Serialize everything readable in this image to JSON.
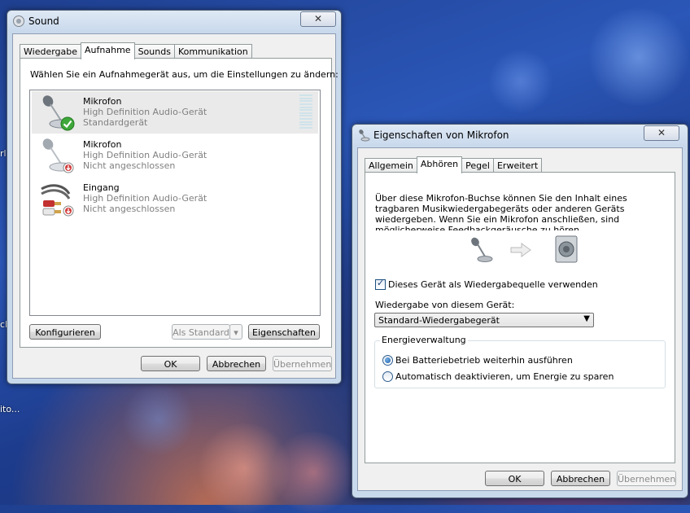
{
  "desktop": {
    "labels": [
      "rl",
      "ch",
      "ito..."
    ]
  },
  "sound": {
    "title": "Sound",
    "close": "✕",
    "tabs": [
      "Wiedergabe",
      "Aufnahme",
      "Sounds",
      "Kommunikation"
    ],
    "instruction": "Wählen Sie ein Aufnahmegerät aus, um die Einstellungen zu ändern:",
    "devices": [
      {
        "name": "Mikrofon",
        "line1": "High Definition Audio-Gerät",
        "line2": "Standardgerät",
        "icon": "microphone-icon",
        "status": "default-check-icon"
      },
      {
        "name": "Mikrofon",
        "line1": "High Definition Audio-Gerät",
        "line2": "Nicht angeschlossen",
        "icon": "microphone-icon",
        "status": "disconnected-icon"
      },
      {
        "name": "Eingang",
        "line1": "High Definition Audio-Gerät",
        "line2": "Nicht angeschlossen",
        "icon": "rca-cable-icon",
        "status": "disconnected-icon"
      }
    ],
    "buttons": {
      "configure": "Konfigurieren",
      "set_default": "Als Standard",
      "properties": "Eigenschaften",
      "ok": "OK",
      "cancel": "Abbrechen",
      "apply": "Übernehmen"
    }
  },
  "props": {
    "title": "Eigenschaften von Mikrofon",
    "close": "✕",
    "tabs": [
      "Allgemein",
      "Abhören",
      "Pegel",
      "Erweitert"
    ],
    "description": "Über diese Mikrofon-Buchse können Sie den Inhalt eines tragbaren Musikwiedergabegeräts oder anderen Geräts wiedergeben. Wenn Sie ein Mikrofon anschließen, sind möglicherweise Feedbackgeräusche zu hören.",
    "checkbox_label": "Dieses Gerät als Wiedergabequelle verwenden",
    "checkbox_checked": true,
    "playback_label": "Wiedergabe von diesem Gerät:",
    "playback_value": "Standard-Wiedergabegerät",
    "energy_title": "Energieverwaltung",
    "energy_options": [
      "Bei Batteriebetrieb weiterhin ausführen",
      "Automatisch deaktivieren, um Energie zu sparen"
    ],
    "energy_selected": 0,
    "buttons": {
      "ok": "OK",
      "cancel": "Abbrechen",
      "apply": "Übernehmen"
    }
  }
}
